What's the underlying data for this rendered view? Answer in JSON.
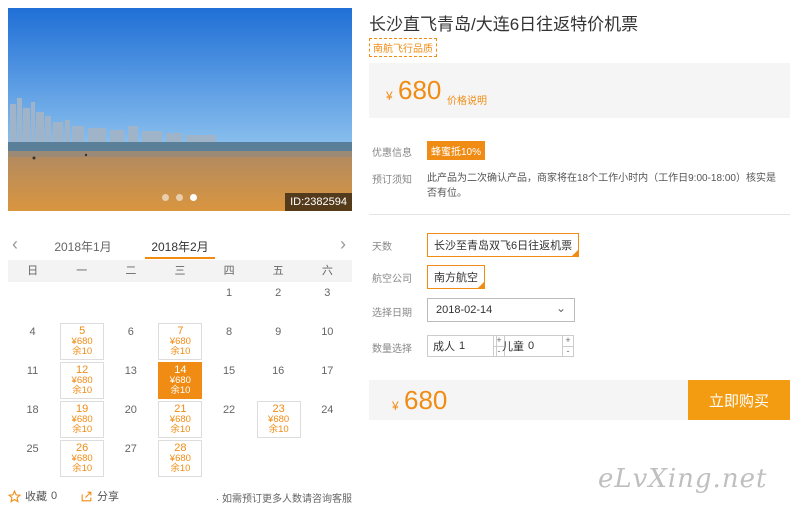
{
  "product": {
    "title": "长沙直飞青岛/大连6日往返特价机票",
    "brand_tag": "南航飞行品质",
    "price_symbol": "¥",
    "price": "680",
    "price_note": "价格说明"
  },
  "photo": {
    "id_label": "ID:2382594",
    "dots": 3,
    "active_dot": 3
  },
  "calendar": {
    "prev_month": "2018年1月",
    "current_month": "2018年2月",
    "weekdays": [
      "日",
      "一",
      "二",
      "三",
      "四",
      "五",
      "六"
    ],
    "weeks": [
      [
        {
          "d": ""
        },
        {
          "d": ""
        },
        {
          "d": ""
        },
        {
          "d": ""
        },
        {
          "d": "1"
        },
        {
          "d": "2"
        },
        {
          "d": "3"
        }
      ],
      [
        {
          "d": "4"
        },
        {
          "d": "5",
          "price": "¥680",
          "left": "余10"
        },
        {
          "d": "6"
        },
        {
          "d": "7",
          "price": "¥680",
          "left": "余10"
        },
        {
          "d": "8"
        },
        {
          "d": "9"
        },
        {
          "d": "10"
        }
      ],
      [
        {
          "d": "11"
        },
        {
          "d": "12",
          "price": "¥680",
          "left": "余10"
        },
        {
          "d": "13"
        },
        {
          "d": "14",
          "price": "¥680",
          "left": "余10",
          "selected": true
        },
        {
          "d": "15"
        },
        {
          "d": "16"
        },
        {
          "d": "17"
        }
      ],
      [
        {
          "d": "18"
        },
        {
          "d": "19",
          "price": "¥680",
          "left": "余10"
        },
        {
          "d": "20"
        },
        {
          "d": "21",
          "price": "¥680",
          "left": "余10"
        },
        {
          "d": "22"
        },
        {
          "d": "23",
          "price": "¥680",
          "left": "余10"
        },
        {
          "d": "24"
        }
      ],
      [
        {
          "d": "25"
        },
        {
          "d": "26",
          "price": "¥680",
          "left": "余10"
        },
        {
          "d": "27"
        },
        {
          "d": "28",
          "price": "¥680",
          "left": "余10"
        },
        {
          "d": ""
        },
        {
          "d": ""
        },
        {
          "d": ""
        }
      ]
    ]
  },
  "bottom": {
    "favorite_label": "收藏",
    "favorite_count": "0",
    "share_label": "分享",
    "consult_text": "· 如需预订更多人数请咨询客服"
  },
  "info": {
    "promo_label": "优惠信息",
    "promo_badge": "蜂蜜抵10%",
    "notice_label": "预订须知",
    "notice_text": "此产品为二次确认产品，商家将在18个工作小时内（工作日9:00-18:00）核实是否有位。"
  },
  "options": {
    "days_label": "天数",
    "days_value": "长沙至青岛双飞6日往返机票",
    "airline_label": "航空公司",
    "airline_value": "南方航空",
    "date_label": "选择日期",
    "date_value": "2018-02-14",
    "qty_label": "数量选择",
    "adult_label": "成人",
    "adult_value": "1",
    "child_label": "儿童",
    "child_value": "0",
    "plus": "+",
    "minus": "-"
  },
  "buy": {
    "price_symbol": "¥",
    "price": "680",
    "button_label": "立即购买"
  },
  "watermark": "eLvXing.net",
  "colors": {
    "accent": "#f08c14",
    "button": "#f39c12"
  }
}
